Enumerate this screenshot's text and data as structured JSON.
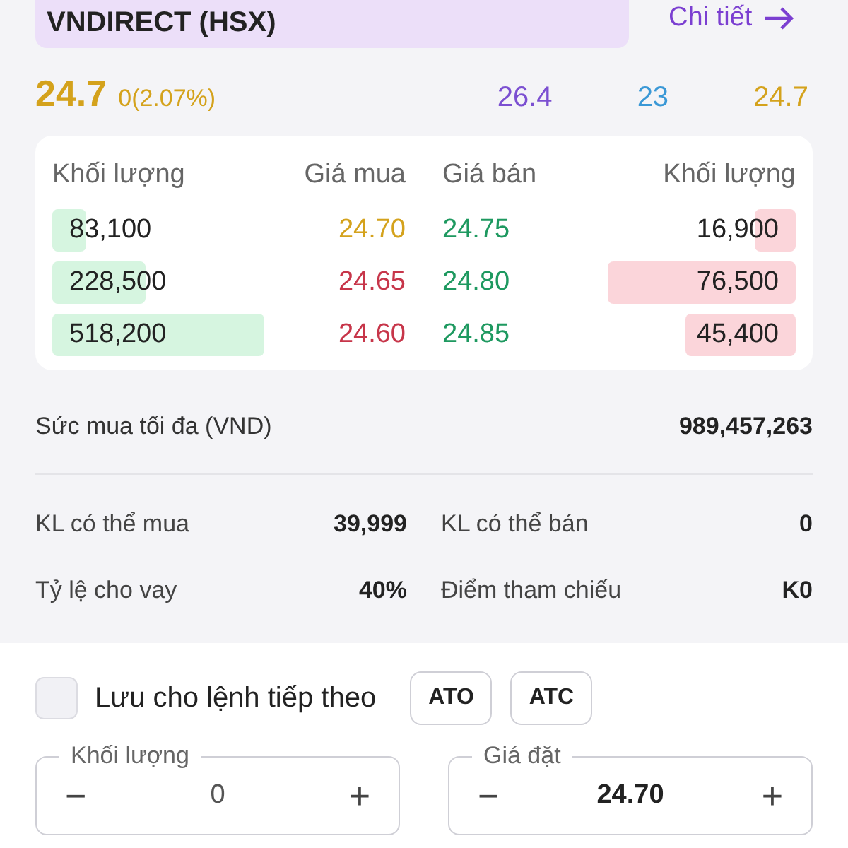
{
  "stock": {
    "name": "VNDIRECT (HSX)",
    "detail_link": "Chi tiết"
  },
  "quote": {
    "price": "24.7",
    "change": "0(2.07%)",
    "ceiling": "26.4",
    "floor": "23",
    "reference": "24.7"
  },
  "order_book": {
    "columns": [
      "Khối lượng",
      "Giá mua",
      "Giá bán",
      "Khối lượng"
    ],
    "rows": [
      {
        "bid": {
          "volume": "83,100",
          "level": 0.16
        },
        "bid_price": {
          "value": "24.70",
          "color": "#d4a21c"
        },
        "ask_price": {
          "value": "24.75",
          "color": "#1e9960"
        },
        "ask": {
          "volume": "16,900",
          "level": 0.22
        }
      },
      {
        "bid": {
          "volume": "228,500",
          "level": 0.44
        },
        "bid_price": {
          "value": "24.65",
          "color": "#c7364a"
        },
        "ask_price": {
          "value": "24.80",
          "color": "#1e9960"
        },
        "ask": {
          "volume": "76,500",
          "level": 1.0
        }
      },
      {
        "bid": {
          "volume": "518,200",
          "level": 1.0
        },
        "bid_price": {
          "value": "24.60",
          "color": "#c7364a"
        },
        "ask_price": {
          "value": "24.85",
          "color": "#1e9960"
        },
        "ask": {
          "volume": "45,400",
          "level": 0.59
        }
      }
    ]
  },
  "buying_power": {
    "label": "Sức mua tối đa (VND)",
    "value": "989,457,263"
  },
  "info": [
    {
      "label": "KL có thể mua",
      "value": "39,999"
    },
    {
      "label": "KL có thể bán",
      "value": "0"
    },
    {
      "label": "Tỷ lệ cho vay",
      "value": "40%"
    },
    {
      "label": "Điểm tham chiếu",
      "value": "K0"
    }
  ],
  "order_form": {
    "save_checkbox": {
      "label": "Lưu cho lệnh tiếp theo",
      "checked": false
    },
    "quick_buttons": [
      "ATO",
      "ATC"
    ],
    "fields": [
      {
        "label": "Khối lượng",
        "decrement": "−",
        "value": "0",
        "increment": "+",
        "bold": false
      },
      {
        "label": "Giá đặt",
        "decrement": "−",
        "value": "24.70",
        "increment": "+",
        "bold": true
      }
    ]
  }
}
